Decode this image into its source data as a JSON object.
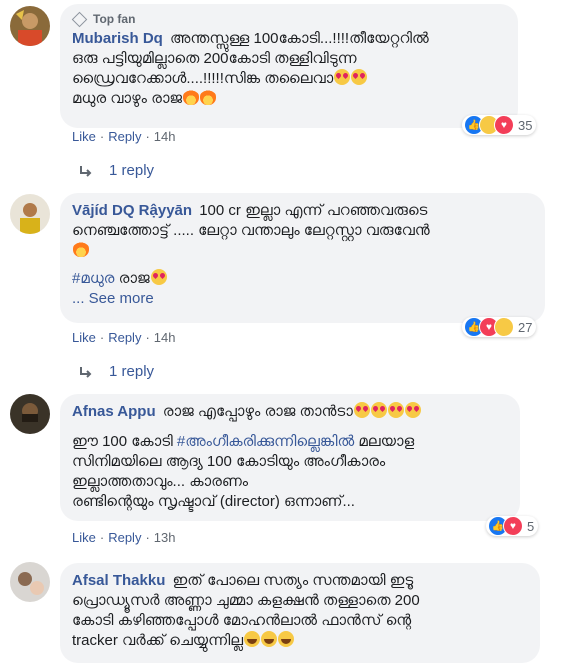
{
  "comments": [
    {
      "top_fan": "Top fan",
      "name": "Mubarish Dq",
      "lines": [
        "അന്തസ്സുള്ള 100കോടി...!!!!തീയേറ്ററിൽ",
        "ഒരു പട്ടിയുമില്ലാതെ 200കോടി തള്ളിവിടുന്ന",
        "ഡ്രൈവറേക്കാൾ....!!!!!സിങ്ക തലൈവാ",
        "മധുര വാഴും രാജ"
      ],
      "reaction_count": "35",
      "like": "Like",
      "reply": "Reply",
      "time": "14h",
      "replies": "1 reply"
    },
    {
      "name": "Vājíd DQ Rậyyān",
      "first_line_rest": "100 cr ഇല്ലാ എന്ന് പറഞ്ഞവരുടെ",
      "lines": [
        "നെഞ്ചത്തോട്ട് ..... ലേറ്റാ വന്താലും ലേറ്റസ്റ്റാ വരുവേൻ"
      ],
      "hashtag": "#മധുര",
      "hashtag_rest": "രാജ",
      "see_more": "... See more",
      "reaction_count": "27",
      "like": "Like",
      "reply": "Reply",
      "time": "14h",
      "replies": "1 reply"
    },
    {
      "name": "Afnas Appu",
      "first_line_rest": "രാജ എപ്പോഴും രാജ താൻടാ",
      "line2_pre": "ഈ 100 കോടി",
      "line2_hashtag": "#അംഗീകരിക്കുന്നില്ലെങ്കിൽ",
      "line2_post": "മലയാള",
      "lines": [
        "സിനിമയിലെ ആദ്യ 100 കോടിയും അംഗീകാരം",
        "ഇല്ലാത്തതാവും... കാരണം",
        "രണ്ടിന്റെയും സൃഷ്ടാവ് (director) ഒന്നാണ്..."
      ],
      "reaction_count": "5",
      "like": "Like",
      "reply": "Reply",
      "time": "13h"
    },
    {
      "name": "Afsal Thakku",
      "first_line_rest": "ഇത് പോലെ സത്യം സന്തമായി ഇടൂ",
      "lines": [
        "പ്രൊഡ്യൂസർ അണ്ണാ ചുമ്മാ കളക്ഷൻ തള്ളാതെ 200",
        "കോടി കഴിഞ്ഞപ്പോൾ മോഹൻലാൽ ഫാൻസ് ന്റെ",
        "tracker വർക്ക് ചെയ്യുന്നില്ല"
      ]
    }
  ],
  "colors": {
    "link": "#385898",
    "bubble": "#f2f3f5",
    "meta": "#606770",
    "like_blue": "#1877f2",
    "love_red": "#f33e58"
  }
}
